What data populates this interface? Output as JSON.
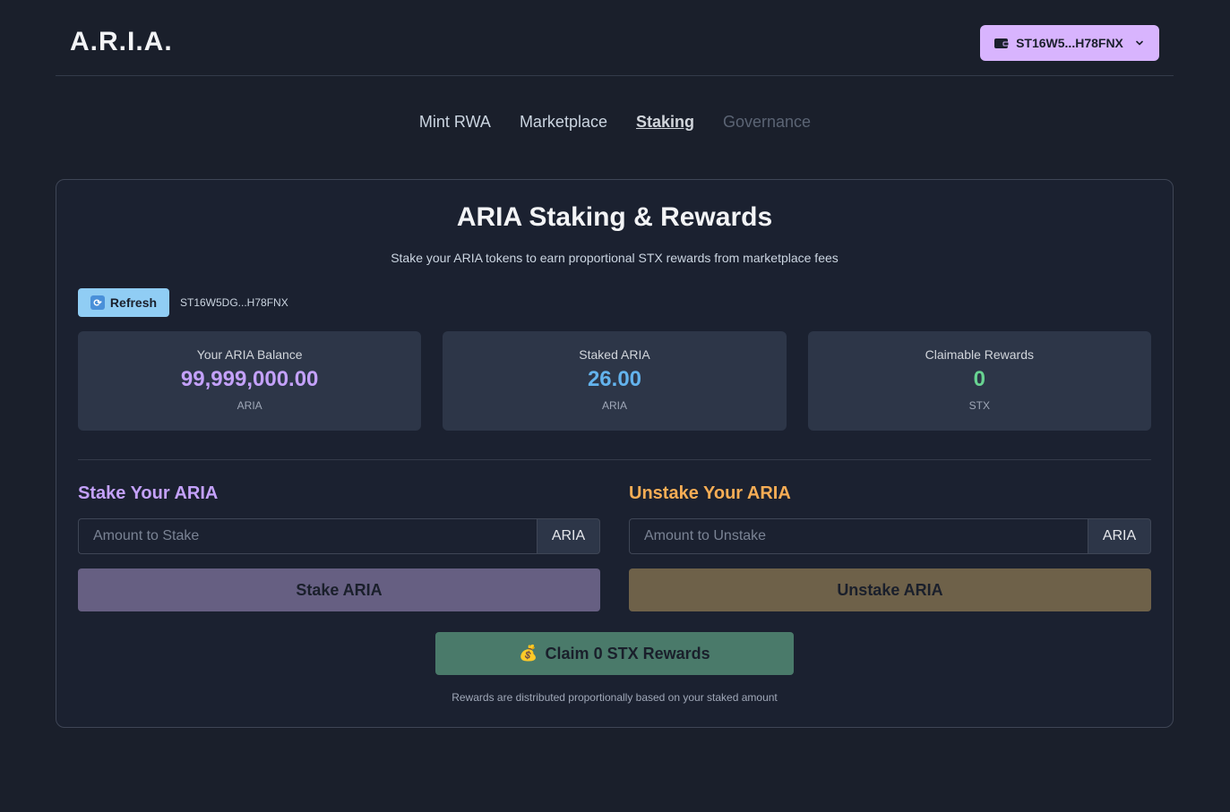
{
  "app": {
    "logo": "A.R.I.A."
  },
  "wallet": {
    "address": "ST16W5...H78FNX",
    "icon": "wallet-icon",
    "chevron": "chevron-down-icon"
  },
  "nav": {
    "items": [
      {
        "label": "Mint RWA",
        "state": "normal"
      },
      {
        "label": "Marketplace",
        "state": "normal"
      },
      {
        "label": "Staking",
        "state": "active"
      },
      {
        "label": "Governance",
        "state": "disabled"
      }
    ]
  },
  "staking": {
    "title": "ARIA Staking & Rewards",
    "subtitle": "Stake your ARIA tokens to earn proportional STX rewards from marketplace fees",
    "refresh_label": "Refresh",
    "refresh_icon": "🔄",
    "address": "ST16W5DG...H78FNX",
    "stats": [
      {
        "label": "Your ARIA Balance",
        "value": "99,999,000.00",
        "unit": "ARIA",
        "color": "#c4a1fb"
      },
      {
        "label": "Staked ARIA",
        "value": "26.00",
        "unit": "ARIA",
        "color": "#63b3ed"
      },
      {
        "label": "Claimable Rewards",
        "value": "0",
        "unit": "STX",
        "color": "#68d391"
      }
    ],
    "stake": {
      "title": "Stake Your ARIA",
      "title_color": "#c4a1fb",
      "placeholder": "Amount to Stake",
      "value": "",
      "unit": "ARIA",
      "button": "Stake ARIA",
      "button_color": "#665f82"
    },
    "unstake": {
      "title": "Unstake Your ARIA",
      "title_color": "#f6ad55",
      "placeholder": "Amount to Unstake",
      "value": "",
      "unit": "ARIA",
      "button": "Unstake ARIA",
      "button_color": "#6e6149"
    },
    "claim": {
      "icon": "💰",
      "label": "Claim 0 STX Rewards",
      "color": "#4a7a6a"
    },
    "footnote": "Rewards are distributed proportionally based on your staked amount"
  }
}
